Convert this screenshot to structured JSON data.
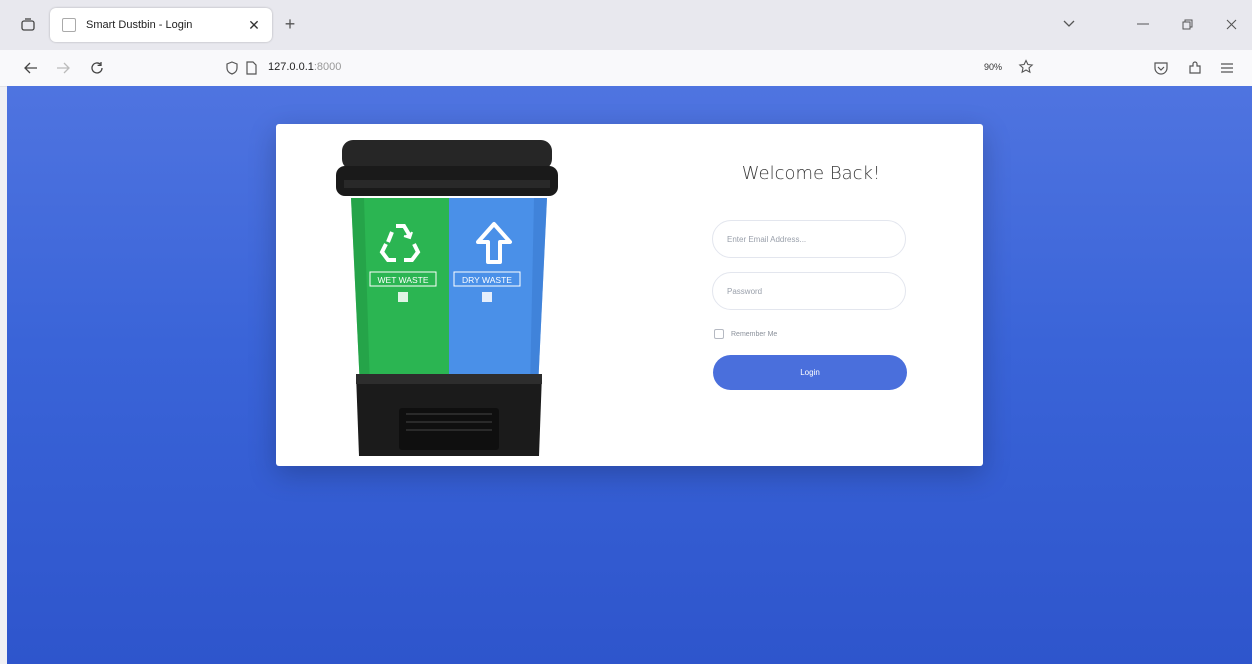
{
  "browser": {
    "tab_title": "Smart Dustbin - Login",
    "url_host": "127.0.0.1",
    "url_port": ":8000",
    "zoom": "90%"
  },
  "icons": {
    "tab_list": "tab-list-icon",
    "back": "arrow-left-icon",
    "forward": "arrow-right-icon",
    "reload": "reload-icon",
    "shield": "shield-icon",
    "page": "page-icon",
    "bookmark": "star-icon",
    "pocket": "pocket-icon",
    "extensions": "extensions-icon",
    "menu": "hamburger-menu-icon"
  },
  "hero": {
    "left_bin_label": "WET WASTE",
    "right_bin_label": "DRY WASTE"
  },
  "login": {
    "heading": "Welcome Back!",
    "email_placeholder": "Enter Email Address...",
    "password_placeholder": "Password",
    "remember_label": "Remember Me",
    "button_label": "Login"
  },
  "colors": {
    "background_gradient_top": "#4f74e0",
    "background_gradient_bottom": "#2e55cc",
    "login_button": "#4a6fdc",
    "wet_bin": "#2bb552",
    "dry_bin": "#4a90e8"
  }
}
